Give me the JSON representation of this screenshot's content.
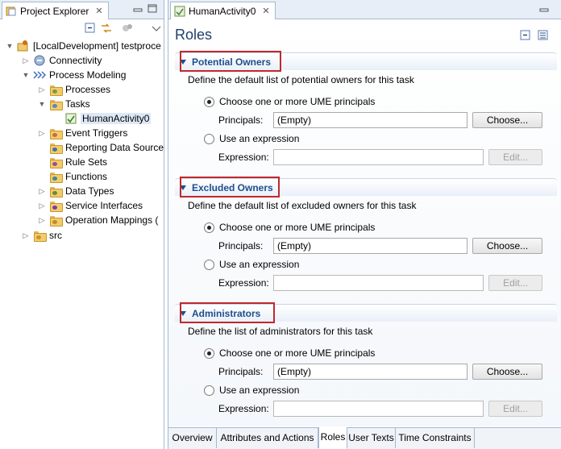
{
  "explorer": {
    "tab_label": "Project Explorer",
    "close_glyph": "✕",
    "tree": [
      {
        "label": "[LocalDevelopment] testproce",
        "icon": "project-icon"
      },
      {
        "label": "Connectivity",
        "icon": "connectivity-icon"
      },
      {
        "label": "Process Modeling",
        "icon": "process-modeling-icon"
      },
      {
        "label": "Processes",
        "icon": "folder-icon"
      },
      {
        "label": "Tasks",
        "icon": "folder-open-icon"
      },
      {
        "label": "HumanActivity0",
        "icon": "human-activity-icon"
      },
      {
        "label": "Event Triggers",
        "icon": "folder-icon"
      },
      {
        "label": "Reporting Data Source",
        "icon": "folder-icon"
      },
      {
        "label": "Rule Sets",
        "icon": "folder-icon"
      },
      {
        "label": "Functions",
        "icon": "folder-icon"
      },
      {
        "label": "Data Types",
        "icon": "folder-icon"
      },
      {
        "label": "Service Interfaces",
        "icon": "folder-icon"
      },
      {
        "label": "Operation Mappings (",
        "icon": "folder-icon"
      },
      {
        "label": "src",
        "icon": "folder-icon"
      }
    ]
  },
  "editor": {
    "tab_label": "HumanActivity0",
    "close_glyph": "✕",
    "form_title": "Roles",
    "choose_one_label": "Choose one or more UME principals",
    "use_expression_label": "Use an expression",
    "principals_label": "Principals:",
    "expression_label": "Expression:",
    "principals_value": "(Empty)",
    "choose_button": "Choose...",
    "edit_button": "Edit...",
    "sections": [
      {
        "title": "Potential Owners",
        "description": "Define the default list of potential owners for this task"
      },
      {
        "title": "Excluded Owners",
        "description": "Define the default list of excluded owners for this task"
      },
      {
        "title": "Administrators",
        "description": "Define the list of administrators for this task"
      }
    ],
    "bottom_tabs": [
      "Overview",
      "Attributes and Actions",
      "Roles",
      "User Texts",
      "Time Constraints"
    ],
    "active_tab": "Roles"
  },
  "colors": {
    "section_title": "#1f4e8c",
    "highlight_box": "#c0282d",
    "form_title": "#1f3f6b"
  }
}
